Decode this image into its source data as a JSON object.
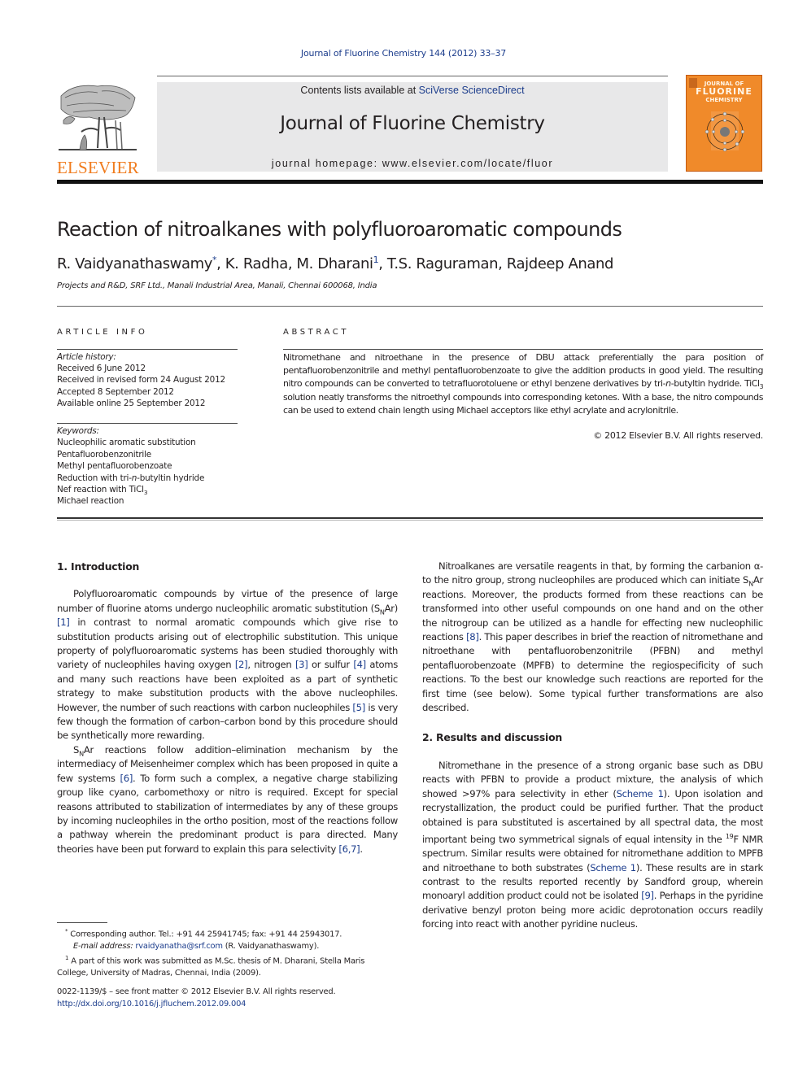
{
  "running_head": "Journal of Fluorine Chemistry 144 (2012) 33–37",
  "banner": {
    "contents_prefix": "Contents lists available at ",
    "contents_link": "SciVerse ScienceDirect",
    "journal_name": "Journal of Fluorine Chemistry",
    "homepage_prefix": "journal homepage: ",
    "homepage_url": "www.elsevier.com/locate/fluor"
  },
  "publisher": {
    "name": "ELSEVIER",
    "color": "#f07c1e"
  },
  "cover": {
    "title_line1": "JOURNAL OF",
    "title_line2": "FLUORINE",
    "title_line3": "CHEMISTRY",
    "color": "#f08a2a"
  },
  "article": {
    "title": "Reaction of nitroalkanes with polyfluoroaromatic compounds",
    "authors": [
      {
        "name": "R. Vaidyanathaswamy",
        "mark": "*"
      },
      {
        "name": "K. Radha",
        "mark": ""
      },
      {
        "name": "M. Dharani",
        "mark": "1"
      },
      {
        "name": "T.S. Raguraman",
        "mark": ""
      },
      {
        "name": "Rajdeep Anand",
        "mark": ""
      }
    ],
    "affiliation": "Projects and R&D, SRF Ltd., Manali Industrial Area, Manali, Chennai 600068, India"
  },
  "article_info": {
    "heading": "ARTICLE INFO",
    "history_label": "Article history:",
    "history": [
      "Received 6 June 2012",
      "Received in revised form 24 August 2012",
      "Accepted 8 September 2012",
      "Available online 25 September 2012"
    ],
    "keywords_label": "Keywords:",
    "keywords": [
      "Nucleophilic aromatic substitution",
      "Pentafluorobenzonitrile",
      "Methyl pentafluorobenzoate",
      "Reduction with tri-n-butyltin hydride",
      "Nef reaction with TiCl3",
      "Michael reaction"
    ]
  },
  "abstract": {
    "heading": "ABSTRACT",
    "p1": "Nitromethane and nitroethane in the presence of DBU attack preferentially the para position of pentafluorobenzonitrile and methyl pentafluorobenzoate to give the addition products in good yield. The resulting nitro compounds can be converted to tetrafluorotoluene or ethyl benzene derivatives by tri-",
    "p1_italic": "n",
    "p2": "-butyltin hydride. TiCl",
    "p2_sub": "3",
    "p3": " solution neatly transforms the nitroethyl compounds into corresponding ketones. With a base, the nitro compounds can be used to extend chain length using Michael acceptors like ethyl acrylate and acrylonitrile.",
    "copyright": "© 2012 Elsevier B.V. All rights reserved."
  },
  "body": {
    "sec1_heading": "1.  Introduction",
    "sec1_p1": {
      "a": "Polyfluoroaromatic compounds by virtue of the presence of large number of fluorine atoms undergo nucleophilic aromatic substitution (S",
      "sub": "N",
      "b": "Ar) ",
      "ref1": "[1]",
      "c": " in contrast to normal aromatic compounds which give rise to substitution products arising out of electrophilic substitution. This unique property of polyfluoroaromatic systems has been studied thoroughly with variety of nucleophiles having oxygen ",
      "ref2": "[2]",
      "d": ", nitrogen ",
      "ref3": "[3]",
      "e": " or sulfur ",
      "ref4": "[4]",
      "f": " atoms and many such reactions have been exploited as a part of synthetic strategy to make substitution products with the above nucleophiles. However, the number of such reactions with carbon nucleophiles ",
      "ref5": "[5]",
      "g": " is very few though the formation of carbon–carbon bond by this procedure should be synthetically more rewarding."
    },
    "sec1_p2": {
      "a": "S",
      "sub": "N",
      "b": "Ar reactions follow addition–elimination mechanism by the intermediacy of Meisenheimer complex which has been proposed in quite a few systems ",
      "ref6": "[6]",
      "c": ". To form such a complex, a negative charge stabilizing group like cyano, carbomethoxy or nitro is required. Except for special reasons attributed to stabilization of intermediates by any of these groups by incoming nucleophiles in the ortho position, most of the reactions follow a pathway wherein the predominant product is para directed. Many theories have been put forward to explain this para selectivity ",
      "ref67": "[6,7]",
      "d": "."
    },
    "sec1_p3": {
      "a": "Nitroalkanes are versatile reagents in that, by forming the carbanion α- to the nitro group, strong nucleophiles are produced which can initiate S",
      "sub": "N",
      "b": "Ar reactions. Moreover, the products formed from these reactions can be transformed into other useful compounds on one hand and on the other the nitrogroup can be utilized as a handle for effecting new nucleophilic reactions ",
      "ref8": "[8]",
      "c": ". This paper describes in brief the reaction of nitromethane and nitroethane with pentafluorobenzonitrile (PFBN) and methyl pentafluorobenzoate (MPFB) to determine the regiospecificity of such reactions. To the best our knowledge such reactions are reported for the first time (see below). Some typical further transformations are also described."
    },
    "sec2_heading": "2.  Results and discussion",
    "sec2_p1": {
      "a": "Nitromethane in the presence of a strong organic base such as DBU reacts with PFBN to provide a product mixture, the analysis of which showed >97% para selectivity in ether (",
      "scheme1": "Scheme 1",
      "b": "). Upon isolation and recrystallization, the product could be purified further. That the product obtained is para substituted is ascertained by all spectral data, the most important being two symmetrical signals of equal intensity in the ",
      "sup": "19",
      "c": "F NMR spectrum. Similar results were obtained for nitromethane addition to MPFB and nitroethane to both substrates (",
      "scheme1b": "Scheme 1",
      "d": "). These results are in stark contrast to the results reported recently by Sandford group, wherein monoaryl addition product could not be isolated ",
      "ref9": "[9]",
      "e": ". Perhaps in the pyridine derivative benzyl proton being more acidic deprotonation occurs readily forcing into react with another pyridine nucleus."
    }
  },
  "footnotes": {
    "fn_star_mark": "*",
    "fn_star": "Corresponding author. Tel.: +91 44 25941745; fax: +91 44 25943017.",
    "email_label": "E-mail address: ",
    "email": "rvaidyanatha@srf.com",
    "email_suffix": " (R. Vaidyanathaswamy).",
    "fn1_mark": "1",
    "fn1": "A part of this work was submitted as M.Sc. thesis of M. Dharani, Stella Maris College, University of Madras, Chennai, India (2009)."
  },
  "front_matter": {
    "issn_line": "0022-1139/$ – see front matter © 2012 Elsevier B.V. All rights reserved.",
    "doi": "http://dx.doi.org/10.1016/j.jfluchem.2012.09.004"
  }
}
